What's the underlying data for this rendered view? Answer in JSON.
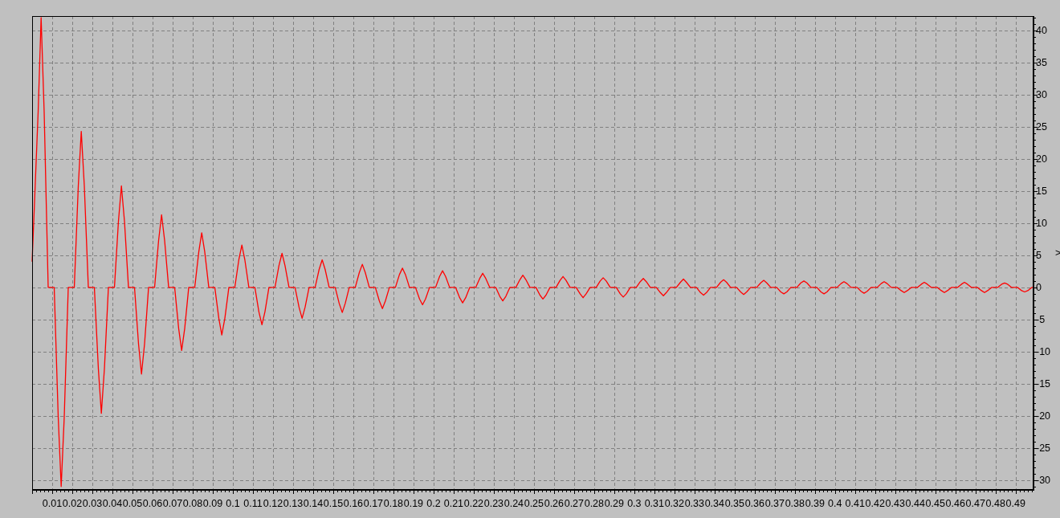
{
  "chart": {
    "chart_data": {
      "type": "line",
      "xlim": [
        0,
        0.4985
      ],
      "ylim": [
        -31.4,
        42.25
      ],
      "xticks": [
        0.01,
        0.02,
        0.03,
        0.04,
        0.05,
        0.06,
        0.07,
        0.08,
        0.09,
        0.1,
        0.11,
        0.12,
        0.13,
        0.14,
        0.15,
        0.16,
        0.17,
        0.18,
        0.19,
        0.2,
        0.21,
        0.22,
        0.23,
        0.24,
        0.25,
        0.26,
        0.27,
        0.28,
        0.29,
        0.3,
        0.31,
        0.32,
        0.33,
        0.34,
        0.35,
        0.36,
        0.37,
        0.38,
        0.39,
        0.4,
        0.41,
        0.42,
        0.43,
        0.44,
        0.45,
        0.46,
        0.47,
        0.48,
        0.49
      ],
      "yticks": [
        -30,
        -25,
        -20,
        -15,
        -10,
        -5,
        0,
        5,
        10,
        15,
        20,
        25,
        30,
        35,
        40
      ],
      "x": [
        0,
        0.003,
        0.0045,
        0.006,
        0.008,
        0.011,
        0.013,
        0.0145,
        0.016,
        0.018,
        0.021,
        0.023,
        0.0245,
        0.026,
        0.028,
        0.031,
        0.033,
        0.0345,
        0.036,
        0.038,
        0.041,
        0.043,
        0.0445,
        0.046,
        0.048,
        0.051,
        0.053,
        0.0545,
        0.056,
        0.058,
        0.061,
        0.063,
        0.0645,
        0.066,
        0.068,
        0.071,
        0.073,
        0.0745,
        0.076,
        0.078,
        0.081,
        0.083,
        0.0845,
        0.086,
        0.088,
        0.091,
        0.093,
        0.0945,
        0.096,
        0.098,
        0.101,
        0.103,
        0.1045,
        0.106,
        0.108,
        0.111,
        0.113,
        0.1145,
        0.116,
        0.118,
        0.121,
        0.123,
        0.1245,
        0.126,
        0.128,
        0.131,
        0.133,
        0.1345,
        0.136,
        0.138,
        0.141,
        0.143,
        0.1445,
        0.146,
        0.148,
        0.151,
        0.153,
        0.1545,
        0.156,
        0.158,
        0.161,
        0.163,
        0.1645,
        0.166,
        0.168,
        0.171,
        0.173,
        0.1745,
        0.176,
        0.178,
        0.181,
        0.183,
        0.1845,
        0.186,
        0.188,
        0.191,
        0.193,
        0.1945,
        0.196,
        0.198,
        0.201,
        0.203,
        0.2045,
        0.206,
        0.208,
        0.211,
        0.213,
        0.2145,
        0.216,
        0.218,
        0.221,
        0.223,
        0.2245,
        0.226,
        0.228,
        0.231,
        0.233,
        0.2345,
        0.236,
        0.238,
        0.241,
        0.243,
        0.2445,
        0.246,
        0.248,
        0.251,
        0.253,
        0.2545,
        0.256,
        0.258,
        0.261,
        0.263,
        0.2645,
        0.266,
        0.268,
        0.271,
        0.273,
        0.2745,
        0.276,
        0.278,
        0.281,
        0.283,
        0.2845,
        0.286,
        0.288,
        0.291,
        0.293,
        0.2945,
        0.296,
        0.298,
        0.301,
        0.303,
        0.3045,
        0.306,
        0.308,
        0.311,
        0.313,
        0.3145,
        0.316,
        0.318,
        0.321,
        0.323,
        0.3245,
        0.326,
        0.328,
        0.331,
        0.333,
        0.3345,
        0.336,
        0.338,
        0.341,
        0.343,
        0.3445,
        0.346,
        0.348,
        0.351,
        0.353,
        0.3545,
        0.356,
        0.358,
        0.361,
        0.363,
        0.3645,
        0.366,
        0.368,
        0.371,
        0.373,
        0.3745,
        0.376,
        0.378,
        0.381,
        0.383,
        0.3845,
        0.386,
        0.388,
        0.391,
        0.393,
        0.3945,
        0.396,
        0.398,
        0.401,
        0.403,
        0.4045,
        0.406,
        0.408,
        0.411,
        0.413,
        0.4145,
        0.416,
        0.418,
        0.421,
        0.423,
        0.4245,
        0.426,
        0.428,
        0.431,
        0.433,
        0.4345,
        0.436,
        0.438,
        0.441,
        0.443,
        0.4445,
        0.446,
        0.448,
        0.451,
        0.453,
        0.4545,
        0.456,
        0.458,
        0.461,
        0.463,
        0.4645,
        0.466,
        0.468,
        0.471,
        0.473,
        0.4745,
        0.476,
        0.478,
        0.481,
        0.483,
        0.4845,
        0.486,
        0.488,
        0.491,
        0.493,
        0.4945,
        0.496,
        0.498,
        0.4985
      ],
      "grid": true,
      "series": [
        {
          "color": "#ff0000",
          "values": [
            4,
            27.3,
            42,
            27.3,
            0,
            0,
            -20.2,
            -31,
            -20.2,
            0,
            0,
            15.8,
            24.3,
            15.8,
            0,
            0,
            -12.7,
            -19.6,
            -12.7,
            0,
            0,
            10.3,
            15.8,
            10.3,
            0,
            0,
            -8.8,
            -13.5,
            -8.8,
            0,
            0,
            7.3,
            11.3,
            7.3,
            0,
            0,
            -6.4,
            -9.8,
            -6.4,
            0,
            0,
            5.5,
            8.5,
            5.5,
            0,
            0,
            -4.8,
            -7.4,
            -4.8,
            0,
            0,
            4.3,
            6.6,
            4.3,
            0,
            0,
            -3.8,
            -5.8,
            -3.8,
            0,
            0,
            3.4,
            5.3,
            3.4,
            0,
            0,
            -3.1,
            -4.8,
            -3.1,
            0,
            0,
            2.8,
            4.3,
            2.8,
            0,
            0,
            -2.5,
            -3.9,
            -2.5,
            0,
            0,
            2.3,
            3.6,
            2.3,
            0,
            0,
            -2.1,
            -3.3,
            -2.1,
            0,
            0,
            2,
            3,
            2,
            0,
            0,
            -1.8,
            -2.7,
            -1.8,
            0,
            0,
            1.7,
            2.6,
            1.7,
            0,
            0,
            -1.6,
            -2.4,
            -1.6,
            0,
            0,
            1.4,
            2.2,
            1.4,
            0,
            0,
            -1.4,
            -2.1,
            -1.4,
            0,
            0,
            1.2,
            1.9,
            1.2,
            0,
            0,
            -1.2,
            -1.8,
            -1.2,
            0,
            0,
            1.1,
            1.7,
            1.1,
            0,
            0,
            -1,
            -1.6,
            -1,
            0,
            0,
            1,
            1.5,
            1,
            0,
            0,
            -1,
            -1.5,
            -1,
            0,
            0,
            0.9,
            1.4,
            0.9,
            0,
            0,
            -0.8,
            -1.3,
            -0.8,
            0,
            0,
            0.8,
            1.3,
            0.8,
            0,
            0,
            -0.8,
            -1.2,
            -0.8,
            0,
            0,
            0.8,
            1.2,
            0.8,
            0,
            0,
            -0.7,
            -1.1,
            -0.7,
            0,
            0,
            0.7,
            1.1,
            0.7,
            0,
            0,
            -0.7,
            -1,
            -0.7,
            0,
            0,
            0.7,
            1,
            0.7,
            0,
            0,
            -0.7,
            -1,
            -0.7,
            0,
            0,
            0.6,
            0.9,
            0.6,
            0,
            0,
            -0.6,
            -0.9,
            -0.6,
            0,
            0,
            0.6,
            0.9,
            0.6,
            0,
            0,
            -0.5,
            -0.8,
            -0.5,
            0,
            0,
            0.5,
            0.8,
            0.5,
            0,
            0,
            -0.5,
            -0.8,
            -0.5,
            0,
            0,
            0.5,
            0.8,
            0.5,
            0,
            0,
            -0.5,
            -0.8,
            -0.5,
            0,
            0,
            0.5,
            0.7,
            0.5,
            0,
            0,
            -0.5,
            -0.7,
            -0.5,
            0,
            0
          ]
        }
      ]
    },
    "edge_mark": ">"
  }
}
